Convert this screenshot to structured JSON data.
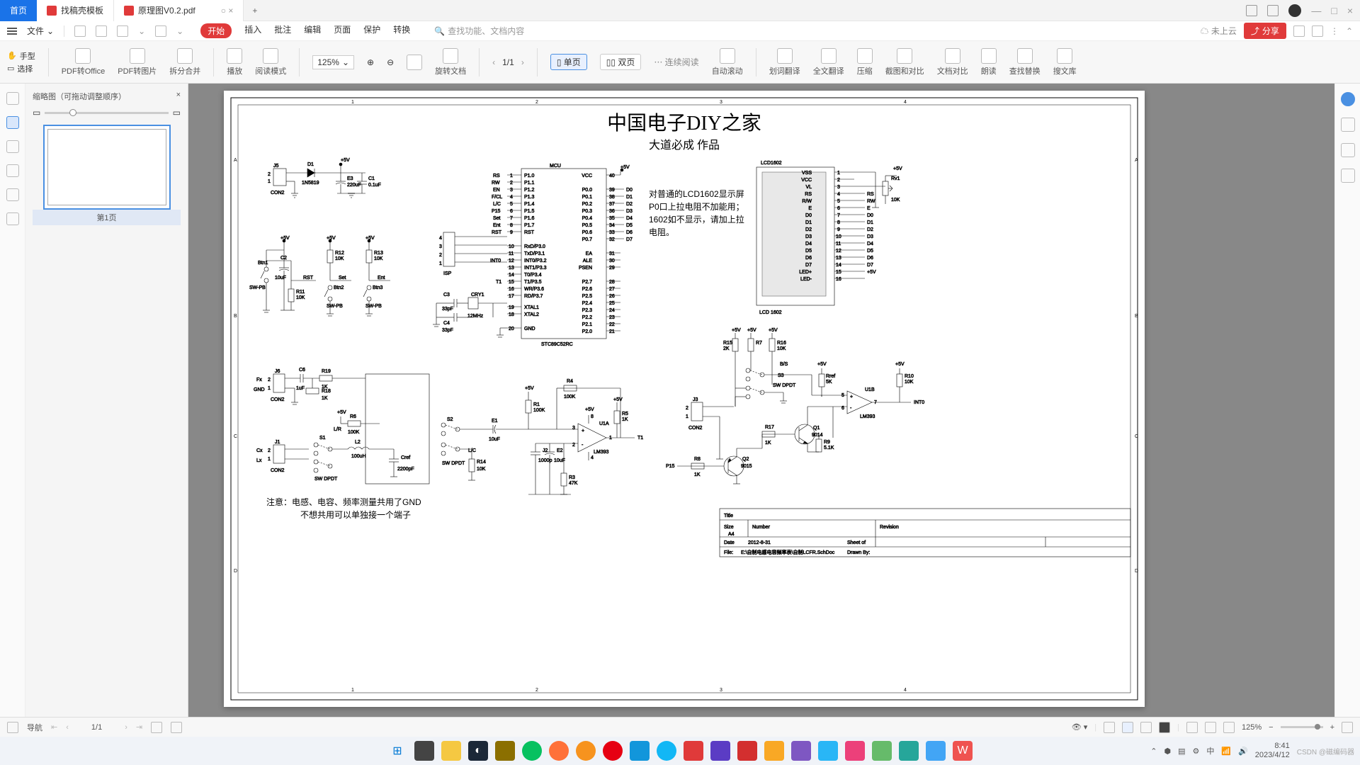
{
  "tabs": {
    "home": "首页",
    "t1": "找稿壳模板",
    "t2": "原理图V0.2.pdf"
  },
  "menu": {
    "file": "文件",
    "items": [
      "开始",
      "插入",
      "批注",
      "编辑",
      "页面",
      "保护",
      "转换"
    ],
    "search_ph": "查找功能、文档内容",
    "cloud": "未上云",
    "share": "分享"
  },
  "ribbon": {
    "sel_hand": "手型",
    "sel_sel": "选择",
    "pdf_office": "PDF转Office",
    "pdf_img": "PDF转图片",
    "split": "拆分合并",
    "play": "播放",
    "readmode": "阅读模式",
    "zoom": "125%",
    "page": "1/1",
    "single": "单页",
    "double": "双页",
    "cont": "连续阅读",
    "autoscroll": "自动滚动",
    "huaci": "划词翻译",
    "fulltrans": "全文翻译",
    "compress": "压缩",
    "screenshot": "截图和对比",
    "doccompare": "文档对比",
    "read": "朗读",
    "findrep": "查找替换",
    "soudoc": "搜文库"
  },
  "thumb": {
    "title": "缩略图（可拖动调整顺序）",
    "page": "第1页"
  },
  "schematic": {
    "title": "中国电子DIY之家",
    "subtitle": "大道必成  作品",
    "note1": "对普通的LCD1602显示屏",
    "note2": "P0口上拉电阻不加能用；",
    "note3": "1602如不显示，请加上拉",
    "note4": "电阻。",
    "note5": "注意：电感、电容、频率测量共用了GND",
    "note6": "不想共用可以单独接一个端子",
    "mcu": "MCU",
    "mcu_part": "STC89C52RC",
    "lcd": "LCD1602",
    "lcd_part": "LCD 1602",
    "comp": {
      "J5": "J5",
      "D1": "D1",
      "D1p": "1N5819",
      "E3": "E3",
      "E3v": "220uF",
      "C1": "C1",
      "C1v": "0.1uF",
      "Btn1": "Btn1",
      "Btn2": "Btn2",
      "Btn3": "Btn3",
      "SWPB": "SW-PB",
      "RST": "RST",
      "Set": "Set",
      "Ent": "Ent",
      "C2": "C2",
      "C2v": "10uF",
      "R11": "R11",
      "R11v": "10K",
      "R12": "R12",
      "R12v": "10K",
      "R13": "R13",
      "R13v": "10K",
      "ISP": "ISP",
      "C3": "C3",
      "C3v": "33pF",
      "C4": "C4",
      "C4v": "33pF",
      "CRY1": "CRY1",
      "CRY1v": "12MHz",
      "Fx": "Fx",
      "Cx": "Cx",
      "Lx": "Lx",
      "GND": "GND",
      "CON2": "CON2",
      "J6": "J6",
      "J1": "J1",
      "C6": "C6",
      "C6v": "1uF",
      "R19": "R19",
      "R19v": "1K",
      "R18": "R18",
      "R18v": "1K",
      "S1": "S1",
      "S2": "S2",
      "S3": "S3",
      "SWDPDT": "SW DPDT",
      "LR": "L/R",
      "LC": "L/C",
      "BS": "B/S",
      "R6": "R6",
      "R6v": "100K",
      "L2": "L2",
      "L2v": "100uH",
      "Cref": "Cref",
      "Cref_v": "2200pF",
      "E1": "E1",
      "E1v": "10uF",
      "R14": "R14",
      "R14v": "10K",
      "R1": "R1",
      "R1v": "100K",
      "J2": "J2",
      "J2v": "1000p",
      "R4": "R4",
      "R4v": "100K",
      "E2": "E2",
      "E2v": "10uF",
      "R3": "R3",
      "R3v": "47K",
      "R5": "R5",
      "R5v": "1K",
      "U1A": "U1A",
      "U1B": "U1B",
      "LM393": "LM393",
      "T1": "T1",
      "INT0": "INT0",
      "J3": "J3",
      "R15": "R15",
      "R15v": "2K",
      "R7": "R7",
      "R16": "R16",
      "R16v": "10K",
      "Rref": "Rref",
      "Rref_v": "5K",
      "R10": "R10",
      "R10v": "10K",
      "R17": "R17",
      "R17v": "1K",
      "Q1": "Q1",
      "Q1p": "9014",
      "Q2": "Q2",
      "Q2p": "9015",
      "R9": "R9",
      "R9v": "5.1K",
      "R8": "R8",
      "R8v": "1K",
      "P15": "P15",
      "Rv1": "Rv1",
      "Rv1v": "10K",
      "5V": "+5V",
      "RS": "RS",
      "RW": "RW",
      "E": "E",
      "VSS": "VSS",
      "VCC": "VCC",
      "VL": "VL",
      "LEDp": "LED+",
      "LEDm": "LED-"
    },
    "titleblock": {
      "Title": "Title",
      "Size": "Size",
      "A4": "A4",
      "Number": "Number",
      "Revision": "Revision",
      "Date": "Date",
      "DateV": "2012-8-31",
      "Sheet": "Sheet    of",
      "File": "File:",
      "FileV": "E:\\自制电感电容频率表\\自制LCFR.SchDoc",
      "Drawn": "Drawn By:"
    }
  },
  "botnav": {
    "nav": "导航",
    "page": "1/1",
    "zoom": "125%"
  },
  "tray": {
    "time": "8:41",
    "date": "2023/4/12"
  },
  "watermark": "CSDN @磁编码器"
}
